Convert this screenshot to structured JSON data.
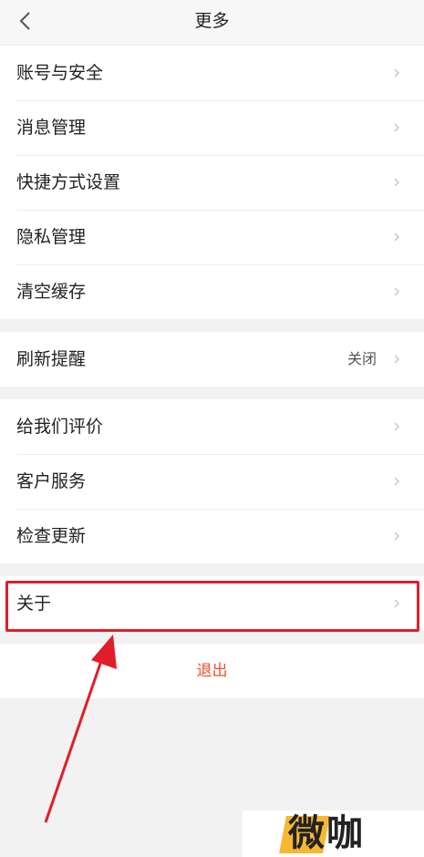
{
  "header": {
    "title": "更多"
  },
  "groups": [
    {
      "items": [
        {
          "label": "账号与安全"
        },
        {
          "label": "消息管理"
        },
        {
          "label": "快捷方式设置"
        },
        {
          "label": "隐私管理"
        },
        {
          "label": "清空缓存"
        }
      ]
    },
    {
      "items": [
        {
          "label": "刷新提醒",
          "value": "关闭"
        }
      ]
    },
    {
      "items": [
        {
          "label": "给我们评价"
        },
        {
          "label": "客户服务"
        },
        {
          "label": "检查更新"
        }
      ]
    },
    {
      "items": [
        {
          "label": "关于"
        }
      ]
    }
  ],
  "logout": {
    "label": "退出"
  },
  "watermark": {
    "text": "微咖"
  },
  "colors": {
    "accent": "#e8542f",
    "highlight": "#e11d2a",
    "logo_yellow": "#f7b733"
  },
  "icons": [
    "back-arrow-icon",
    "chevron-right-icon"
  ]
}
